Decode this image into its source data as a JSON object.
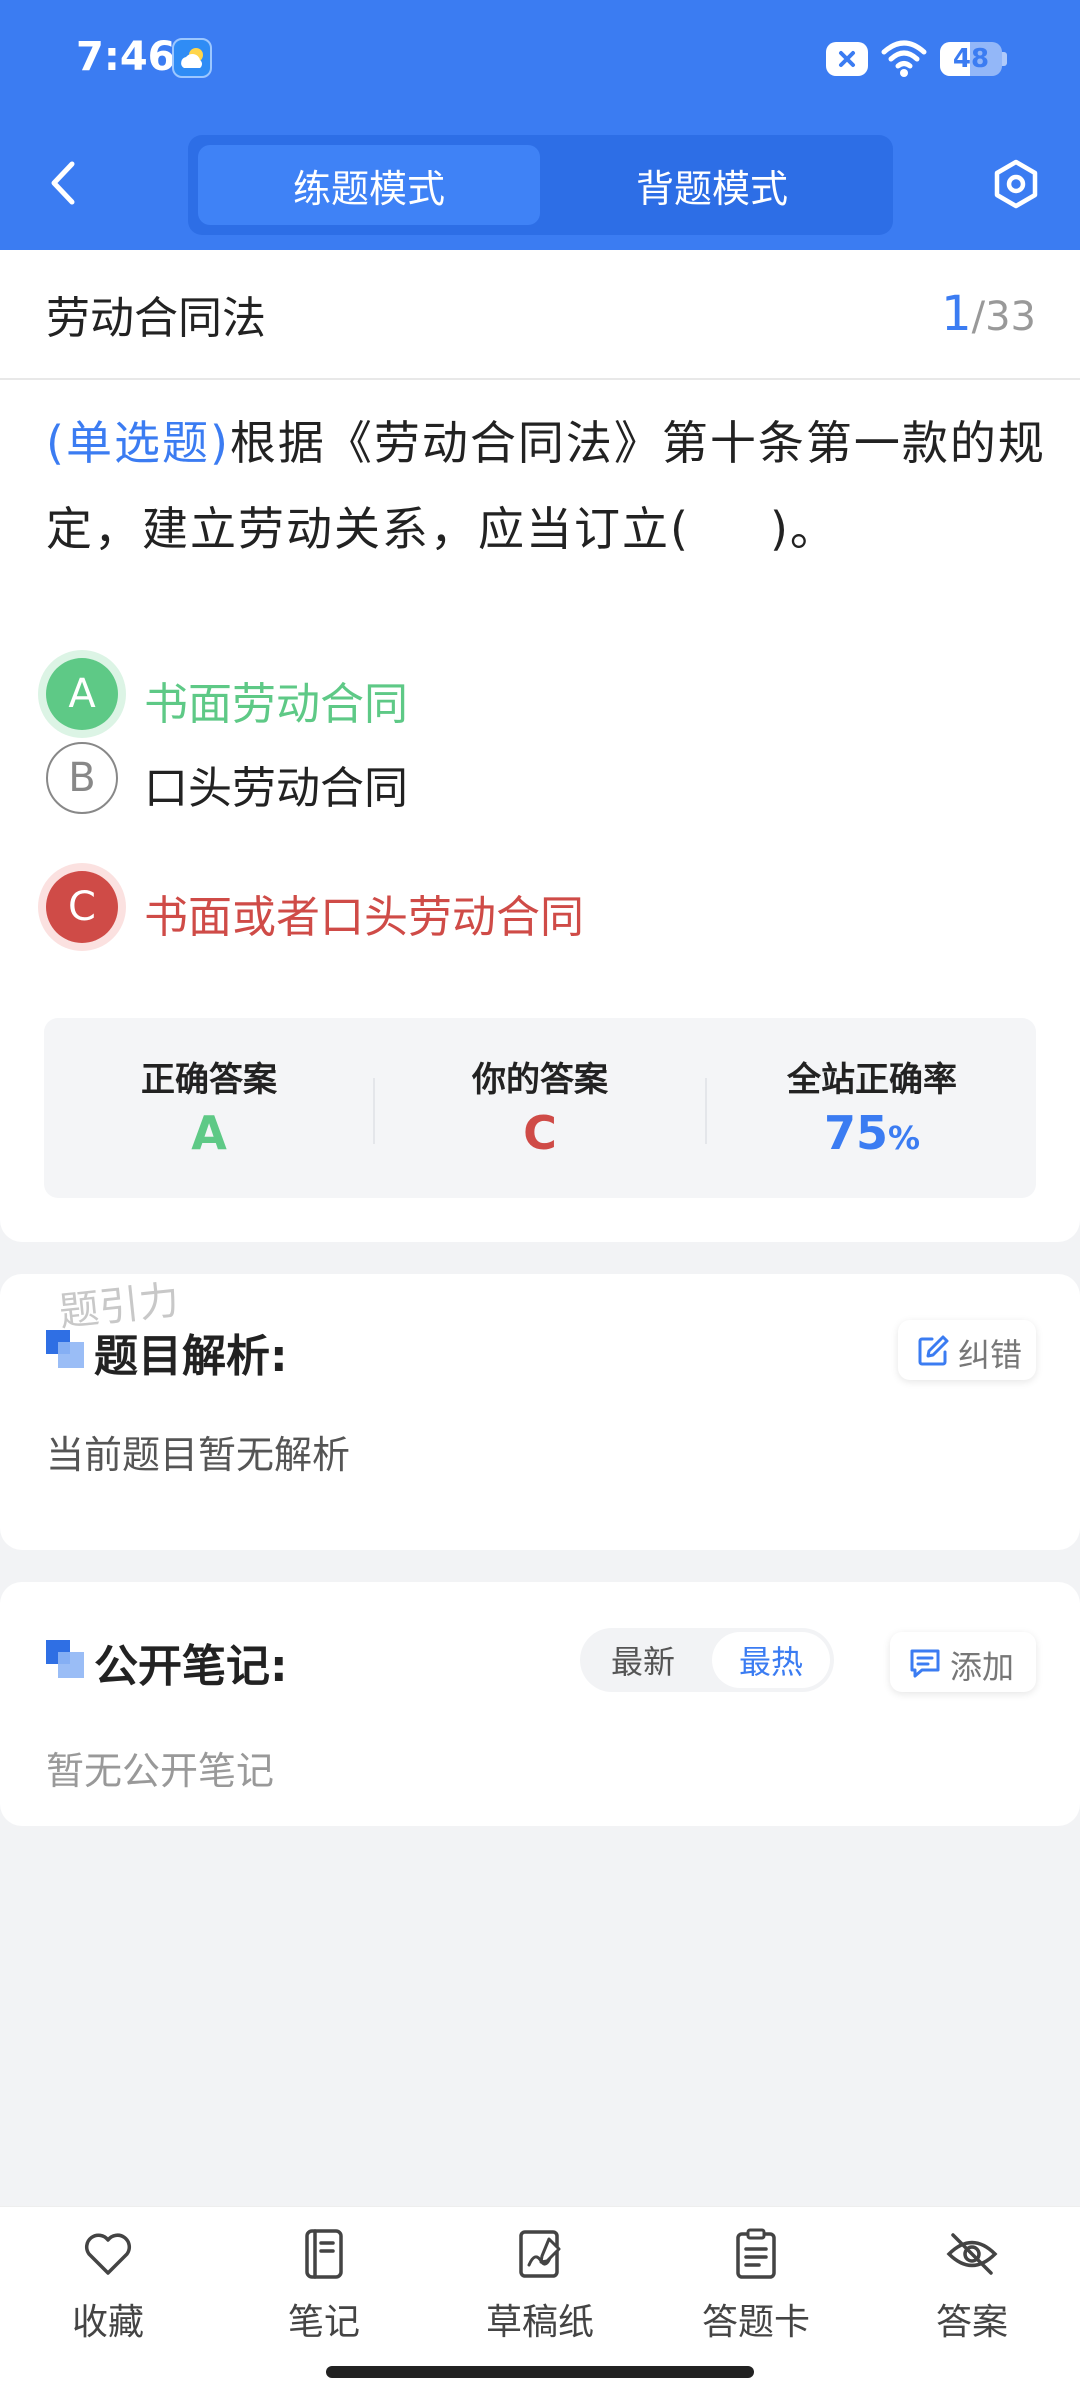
{
  "status_bar": {
    "time": "7:46",
    "battery": "48",
    "battery_level_percent": 48
  },
  "header": {
    "tabs": [
      {
        "label": "练题模式",
        "active": true
      },
      {
        "label": "背题模式",
        "active": false
      }
    ]
  },
  "question": {
    "subject": "劳动合同法",
    "progress_current": "1",
    "progress_total": "/33",
    "type_label": "(单选题)",
    "text_part1": "根据《劳动合同法》第十条第一款的规定，建立劳动关系，应当订立(",
    "text_part2": ")。",
    "options": [
      {
        "letter": "A",
        "text": "书面劳动合同",
        "state": "correct"
      },
      {
        "letter": "B",
        "text": "口头劳动合同",
        "state": "normal"
      },
      {
        "letter": "C",
        "text": "书面或者口头劳动合同",
        "state": "wrong"
      }
    ],
    "stats": {
      "correct_label": "正确答案",
      "correct_value": "A",
      "yours_label": "你的答案",
      "yours_value": "C",
      "rate_label": "全站正确率",
      "rate_value": "75",
      "rate_suffix": "%"
    }
  },
  "watermark": "题引力",
  "analysis": {
    "title": "题目解析:",
    "body": "当前题目暂无解析",
    "report_label": "纠错"
  },
  "notes": {
    "title": "公开笔记:",
    "body": "暂无公开笔记",
    "sort_latest": "最新",
    "sort_hot": "最热",
    "add_label": "添加"
  },
  "bottom_nav": [
    {
      "label": "收藏",
      "icon": "heart-icon"
    },
    {
      "label": "笔记",
      "icon": "notebook-icon"
    },
    {
      "label": "草稿纸",
      "icon": "draft-icon"
    },
    {
      "label": "答题卡",
      "icon": "answer-sheet-icon"
    },
    {
      "label": "答案",
      "icon": "eye-off-icon"
    }
  ],
  "colors": {
    "primary": "#3b7cf2",
    "correct": "#5ec986",
    "wrong": "#cf4b47"
  }
}
